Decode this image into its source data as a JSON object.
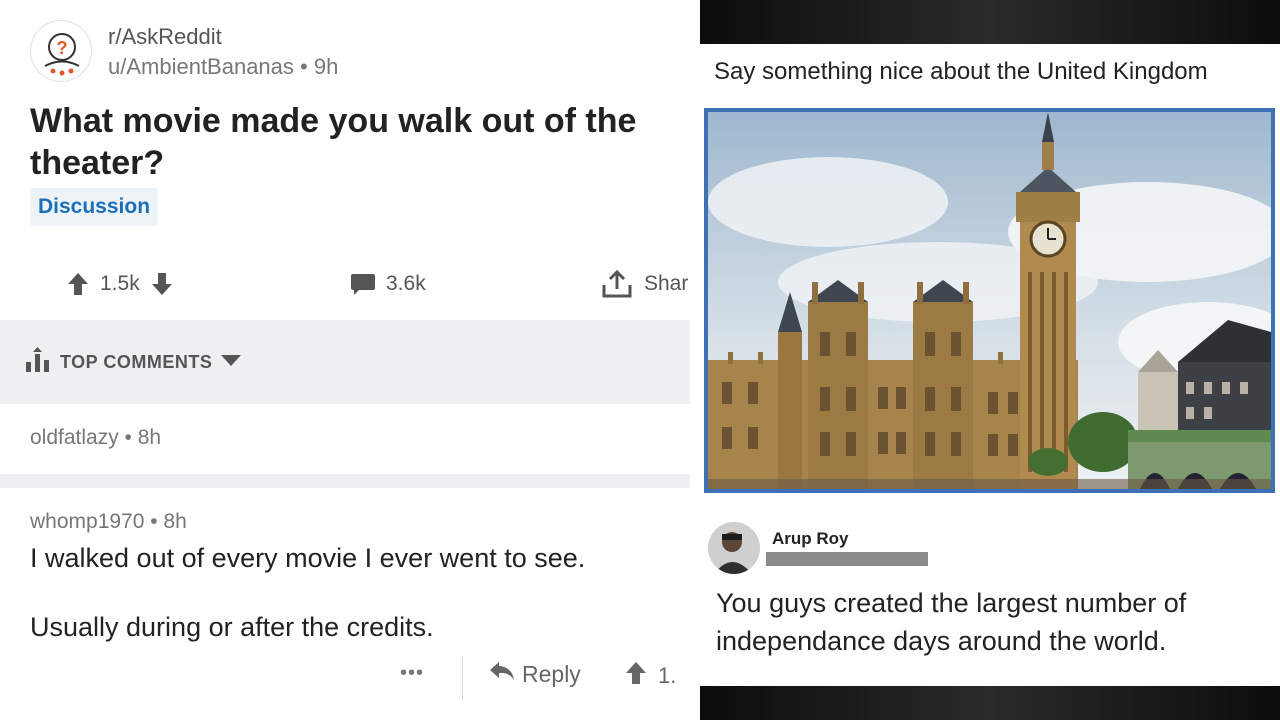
{
  "left_panel": {
    "subreddit": "r/AskReddit",
    "byline": "u/AmbientBananas • 9h",
    "post_title": "What movie made you walk out of the theater?",
    "flair": "Discussion",
    "actions": {
      "upvotes": "1.5k",
      "comments": "3.6k",
      "share": "Shar"
    },
    "sort_label": "TOP COMMENTS",
    "comment1": {
      "meta": "oldfatlazy • 8h"
    },
    "comment2": {
      "meta": "whomp1970 • 8h",
      "line1": "I walked out of every movie I ever went to see.",
      "line2": "Usually during or after the credits.",
      "more": "•••",
      "reply": "Reply",
      "votes": "1."
    }
  },
  "right_panel": {
    "title": "Say something nice about the United Kingdom",
    "commenter": "Arup Roy",
    "comment": "You guys created the largest number of independance days around the world."
  },
  "colors": {
    "flair_text": "#1b6fb8",
    "sort_bar_bg": "#edeff1",
    "photo_border": "#3f6fb5"
  },
  "icons": [
    "reddit-snoo-icon",
    "upvote-icon",
    "downvote-icon",
    "comment-icon",
    "share-icon",
    "sort-bars-icon",
    "caret-down-icon",
    "reply-icon"
  ]
}
